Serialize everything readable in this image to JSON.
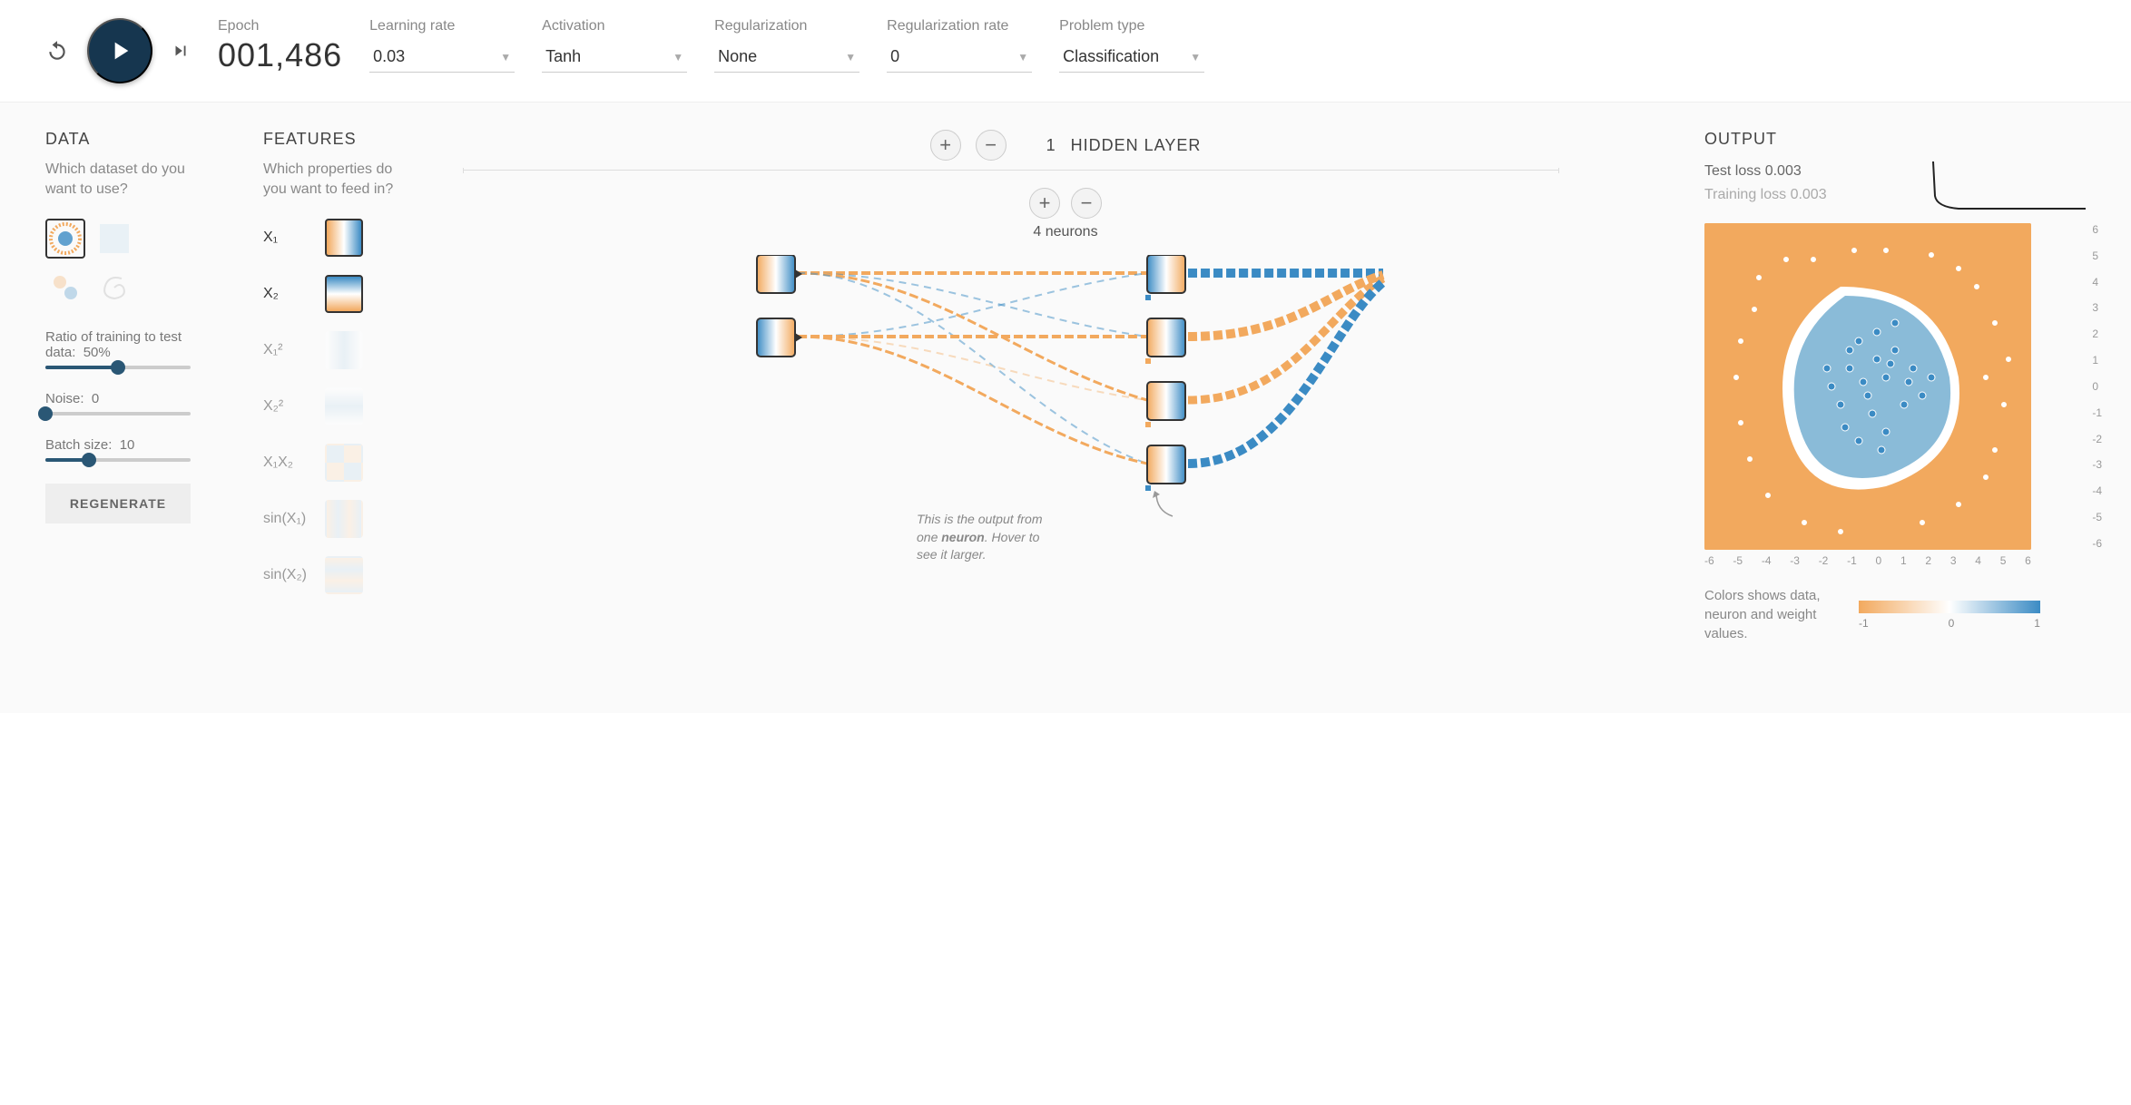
{
  "top": {
    "epoch_label": "Epoch",
    "epoch_value": "001,486",
    "learning_rate_label": "Learning rate",
    "learning_rate_value": "0.03",
    "activation_label": "Activation",
    "activation_value": "Tanh",
    "regularization_label": "Regularization",
    "regularization_value": "None",
    "reg_rate_label": "Regularization rate",
    "reg_rate_value": "0",
    "problem_label": "Problem type",
    "problem_value": "Classification"
  },
  "data": {
    "title": "DATA",
    "subtitle": "Which dataset do you want to use?",
    "ratio_label": "Ratio of training to test data:",
    "ratio_value": "50%",
    "noise_label": "Noise:",
    "noise_value": "0",
    "batch_label": "Batch size:",
    "batch_value": "10",
    "regenerate_label": "REGENERATE"
  },
  "features": {
    "title": "FEATURES",
    "subtitle": "Which properties do you want to feed in?",
    "items": [
      {
        "label": "X₁",
        "active": true
      },
      {
        "label": "X₂",
        "active": true
      },
      {
        "label": "X₁²",
        "active": false
      },
      {
        "label": "X₂²",
        "active": false
      },
      {
        "label": "X₁X₂",
        "active": false
      },
      {
        "label": "sin(X₁)",
        "active": false
      },
      {
        "label": "sin(X₂)",
        "active": false
      }
    ]
  },
  "network": {
    "hidden_count": "1",
    "hidden_label": "HIDDEN LAYER",
    "neurons_label": "4 neurons",
    "callout_prefix": "This is the output from one ",
    "callout_bold": "neuron",
    "callout_suffix": ". Hover to see it larger."
  },
  "output": {
    "title": "OUTPUT",
    "test_loss_label": "Test loss",
    "test_loss_value": "0.003",
    "train_loss_label": "Training loss",
    "train_loss_value": "0.003",
    "axis_ticks": [
      "-6",
      "-5",
      "-4",
      "-3",
      "-2",
      "-1",
      "0",
      "1",
      "2",
      "3",
      "4",
      "5",
      "6"
    ],
    "legend_text": "Colors shows data, neuron and weight values.",
    "legend_ticks": [
      "-1",
      "0",
      "1"
    ]
  },
  "colors": {
    "orange": "#f2a95e",
    "blue": "#3b8bc4",
    "dark": "#16364f"
  },
  "chart_data": {
    "type": "heatmap",
    "title": "OUTPUT",
    "xlim": [
      -6,
      6
    ],
    "ylim": [
      -6,
      6
    ],
    "color_range": [
      -1,
      1
    ],
    "description": "Classification decision surface: central blob region classified blue (~+1), outer region orange (~-1). Scatter points form a blue inner cluster and an orange outer ring.",
    "loss_curve": {
      "type": "line",
      "description": "Loss vs epoch; sharp initial drop then flat near 0",
      "approx_points": [
        [
          0,
          0.5
        ],
        [
          20,
          0.05
        ],
        [
          1486,
          0.003
        ]
      ]
    }
  }
}
